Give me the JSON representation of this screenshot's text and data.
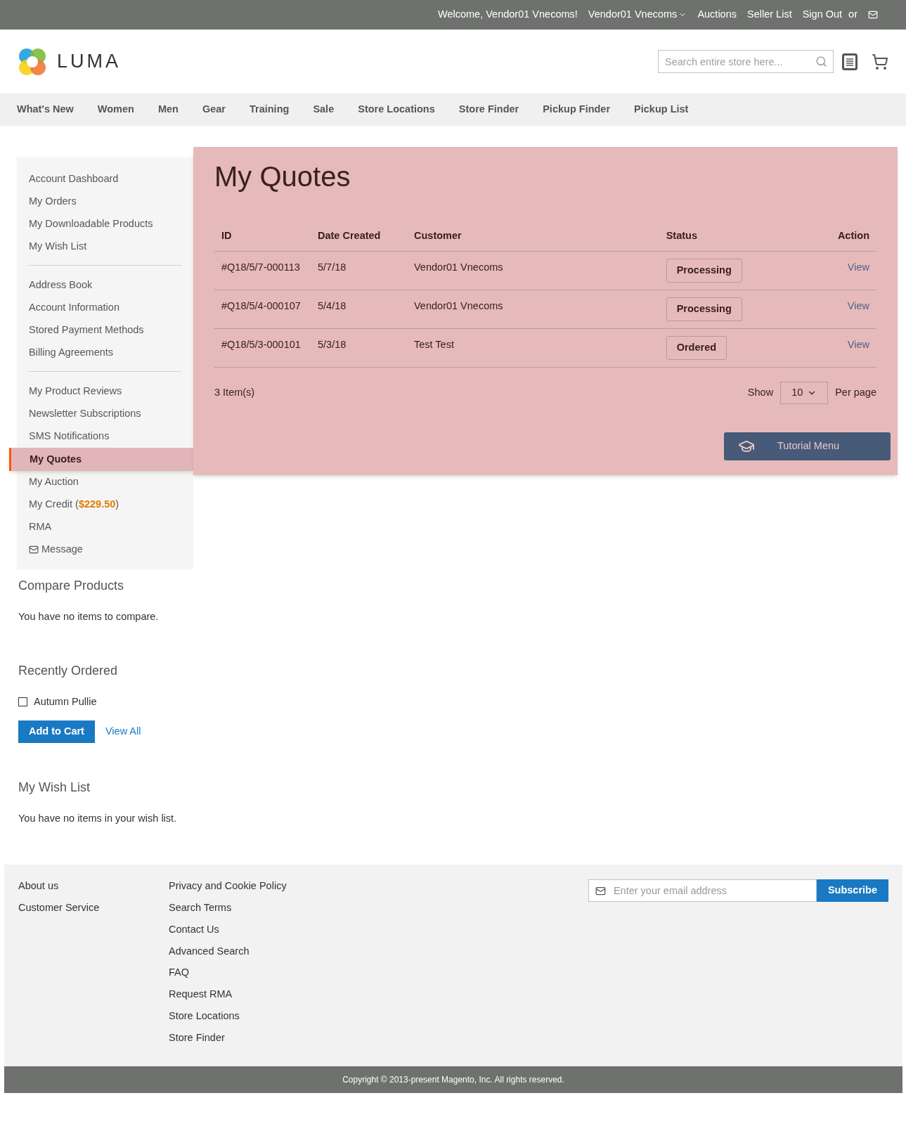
{
  "top_bar": {
    "welcome": "Welcome, Vendor01 Vnecoms!",
    "account": "Vendor01 Vnecoms",
    "links": [
      "Auctions",
      "Seller List",
      "Sign Out"
    ],
    "or": "or"
  },
  "header": {
    "logo": "LUMA",
    "search": {
      "placeholder": "Search entire store here..."
    }
  },
  "nav": [
    "What's New",
    "Women",
    "Men",
    "Gear",
    "Training",
    "Sale",
    "Store Locations",
    "Store Finder",
    "Pickup Finder",
    "Pickup List"
  ],
  "sidebar": {
    "groups": [
      [
        {
          "label": "Account Dashboard",
          "kind": "link",
          "selected": false
        },
        {
          "label": "My Orders",
          "kind": "link",
          "selected": false
        },
        {
          "label": "My Downloadable Products",
          "kind": "link",
          "selected": false
        },
        {
          "label": "My Wish List",
          "kind": "link",
          "selected": false
        }
      ],
      [
        {
          "label": "Address Book",
          "kind": "link",
          "selected": false
        },
        {
          "label": "Account Information",
          "kind": "link",
          "selected": false
        },
        {
          "label": "Stored Payment Methods",
          "kind": "link",
          "selected": false
        },
        {
          "label": "Billing Agreements",
          "kind": "link",
          "selected": false
        }
      ],
      [
        {
          "label": "My Product Reviews",
          "kind": "link",
          "selected": false
        },
        {
          "label": "Newsletter Subscriptions",
          "kind": "link",
          "selected": false
        },
        {
          "label": "SMS Notifications",
          "kind": "link",
          "selected": false
        },
        {
          "label": "My Quotes",
          "kind": "link",
          "selected": true
        },
        {
          "label": "My Auction",
          "kind": "link",
          "selected": false
        },
        {
          "label": "My Credit (**$229.50**)",
          "kind": "link",
          "selected": false
        },
        {
          "label": "RMA",
          "kind": "link",
          "selected": false
        },
        {
          "label": "Message",
          "kind": "message",
          "selected": false
        }
      ]
    ]
  },
  "compare": {
    "title": "Compare Products",
    "text": "You have no items to compare."
  },
  "recently_ordered": {
    "title": "Recently Ordered",
    "items": [
      {
        "label": "Autumn Pullie",
        "checked": false
      }
    ],
    "add_button": "Add to Cart",
    "view_all": "View All"
  },
  "wish_list": {
    "title": "My Wish List",
    "text": "You have no items in your wish list."
  },
  "main": {
    "title": "My Quotes",
    "table": {
      "columns": [
        "ID",
        "Date Created",
        "Customer",
        "Status",
        "Action"
      ],
      "rows": [
        {
          "id": "#Q18/5/7-000113",
          "date": "5/7/18",
          "customer": "Vendor01 Vnecoms",
          "status": "Processing",
          "action": "View"
        },
        {
          "id": "#Q18/5/4-000107",
          "date": "5/4/18",
          "customer": "Vendor01 Vnecoms",
          "status": "Processing",
          "action": "View"
        },
        {
          "id": "#Q18/5/3-000101",
          "date": "5/3/18",
          "customer": "Test Test",
          "status": "Ordered",
          "action": "View"
        }
      ]
    },
    "count": "3 Item(s)",
    "show": "Show",
    "per_page_value": "10",
    "per_page": "Per page",
    "tutorial_button": "Tutorial Menu"
  },
  "footer": {
    "column_1": [
      "About us",
      "Customer Service"
    ],
    "column_2": [
      "Privacy and Cookie Policy",
      "Search Terms",
      "Contact Us",
      "Advanced Search",
      "FAQ",
      "Request RMA",
      "Store Locations",
      "Store Finder"
    ],
    "newsletter": {
      "placeholder": "Enter your email address",
      "button": "Subscribe"
    },
    "copyright": "Copyright © 2013-present Magento, Inc. All rights reserved."
  }
}
